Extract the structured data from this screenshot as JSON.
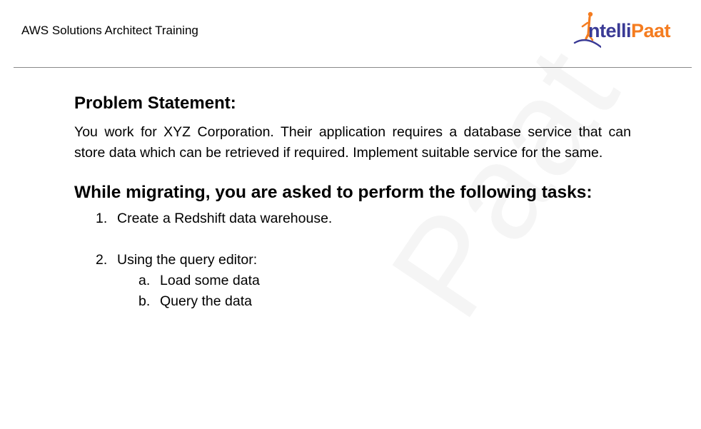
{
  "header": {
    "title": "AWS Solutions Architect Training"
  },
  "logo": {
    "part1": "ntelli",
    "part2": "Paat",
    "icon": "intellipaat-figure-icon",
    "color_primary": "#3a3a95",
    "color_accent": "#f47c20"
  },
  "watermark": {
    "text": "Paat"
  },
  "problem": {
    "heading": "Problem Statement:",
    "body": "You work for XYZ Corporation. Their application requires a database service that can store data which can be retrieved if required. Implement suitable service for the same."
  },
  "tasks": {
    "heading": "While migrating, you are asked to perform the following tasks:",
    "items": [
      {
        "num": "1.",
        "text": "Create a Redshift data warehouse."
      },
      {
        "num": "2.",
        "text": "Using the query editor:"
      }
    ],
    "subitems": [
      {
        "num": "a.",
        "text": "Load some data"
      },
      {
        "num": "b.",
        "text": "Query the data"
      }
    ]
  }
}
